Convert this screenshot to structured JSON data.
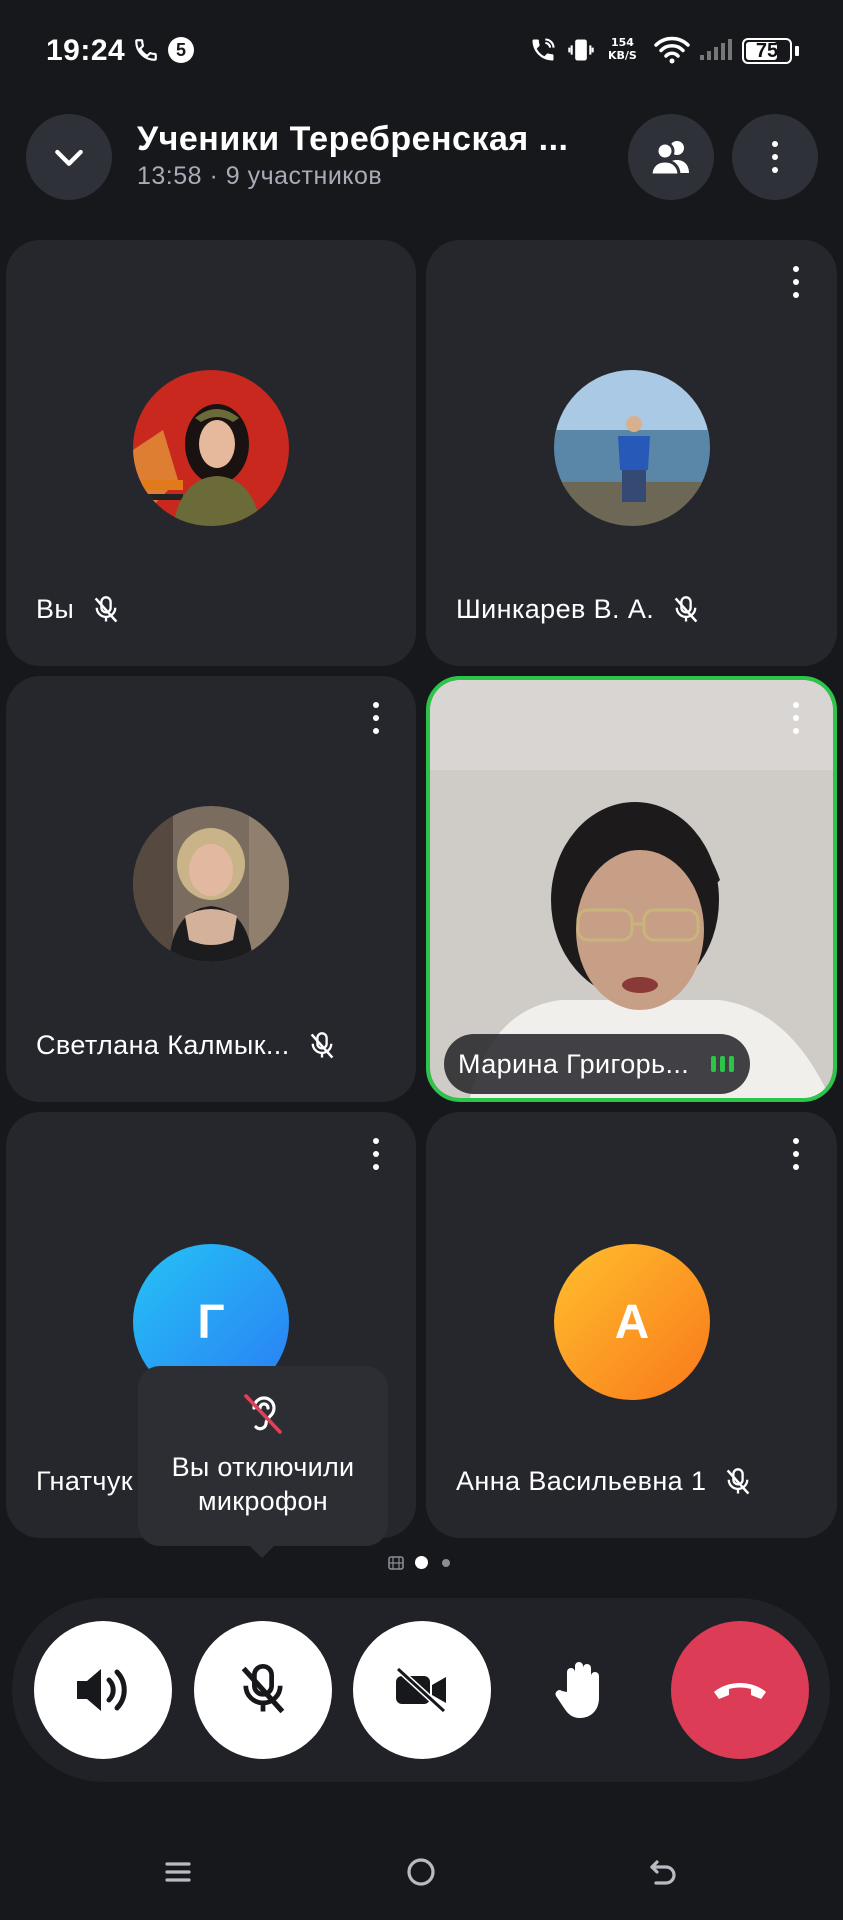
{
  "status_bar": {
    "time": "19:24",
    "speed_value": "154",
    "speed_unit": "KB/S",
    "battery": "75",
    "battery_level": 0.75,
    "icons": [
      "phone-icon",
      "sim-5-icon",
      "wifi-calling-icon",
      "vibrate-icon",
      "wifi-icon",
      "signal-icon"
    ]
  },
  "header": {
    "title": "Ученики Теребренская ...",
    "subtitle": "13:58 · 9 участников",
    "icons": [
      "chevron-down-icon",
      "participants-icon",
      "more-vertical-icon"
    ]
  },
  "participants": [
    {
      "name": "Вы",
      "avatar_type": "photo",
      "muted": true,
      "has_menu": false
    },
    {
      "name": "Шинкарев В. А.",
      "avatar_type": "photo",
      "muted": true,
      "has_menu": true
    },
    {
      "name": "Светлана Калмык...",
      "avatar_type": "photo",
      "muted": true,
      "has_menu": true
    },
    {
      "name": "Марина Григорь...",
      "avatar_type": "video",
      "speaking": true,
      "active": true,
      "has_menu": true
    },
    {
      "name": "Гнатчук",
      "avatar_type": "letter",
      "letter": "Г",
      "muted": true,
      "has_menu": true
    },
    {
      "name": "Анна Васильевна 1",
      "avatar_type": "letter",
      "letter": "А",
      "muted": true,
      "has_menu": true
    }
  ],
  "toast": {
    "text_line1": "Вы отключили",
    "text_line2": "микрофон"
  },
  "pager": {
    "pages": 2,
    "current": 1
  },
  "controls": [
    "speaker-icon",
    "mic-off-icon",
    "camera-off-icon",
    "raise-hand-icon",
    "end-call-icon"
  ],
  "nav": [
    "menu-icon",
    "home-icon",
    "back-icon"
  ],
  "colors": {
    "background": "#17181c",
    "tile": "#26272d",
    "active_border": "#2bc548",
    "end_call": "#dc3c55",
    "avatar_blue": "#2a9df4",
    "avatar_orange": "#fb8c1e"
  }
}
